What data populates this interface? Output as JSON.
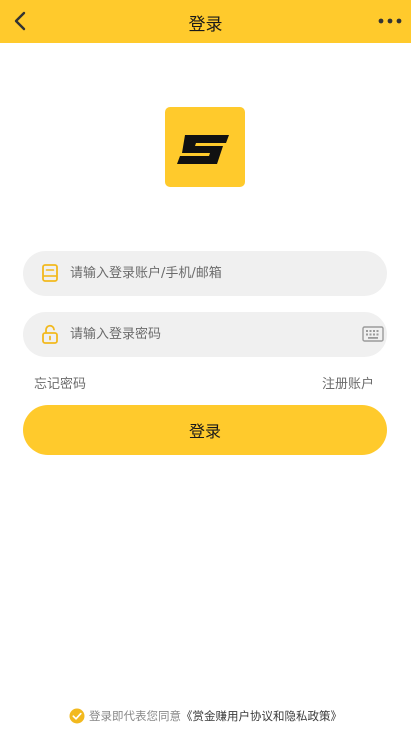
{
  "header": {
    "title": "登录",
    "back_icon": "chevron-left-icon",
    "more_icon": "more-horizontal-icon"
  },
  "logo": {
    "letter": "S",
    "bg_color": "#FFCA2C"
  },
  "form": {
    "account": {
      "placeholder": "请输入登录账户/手机/邮箱",
      "value": "",
      "icon": "account-icon"
    },
    "password": {
      "placeholder": "请输入登录密码",
      "value": "",
      "icon": "lock-icon",
      "keyboard_icon": "keyboard-icon"
    },
    "forgot_label": "忘记密码",
    "register_label": "注册账户",
    "submit_label": "登录"
  },
  "agreement": {
    "prefix": "登录即代表您同意",
    "link": "《赏金赚用户协议和隐私政策》",
    "checked": true
  },
  "colors": {
    "accent": "#FFCA2C",
    "field_bg": "#F0F0F0",
    "placeholder": "#6B6B6B",
    "muted_text": "#888888"
  }
}
